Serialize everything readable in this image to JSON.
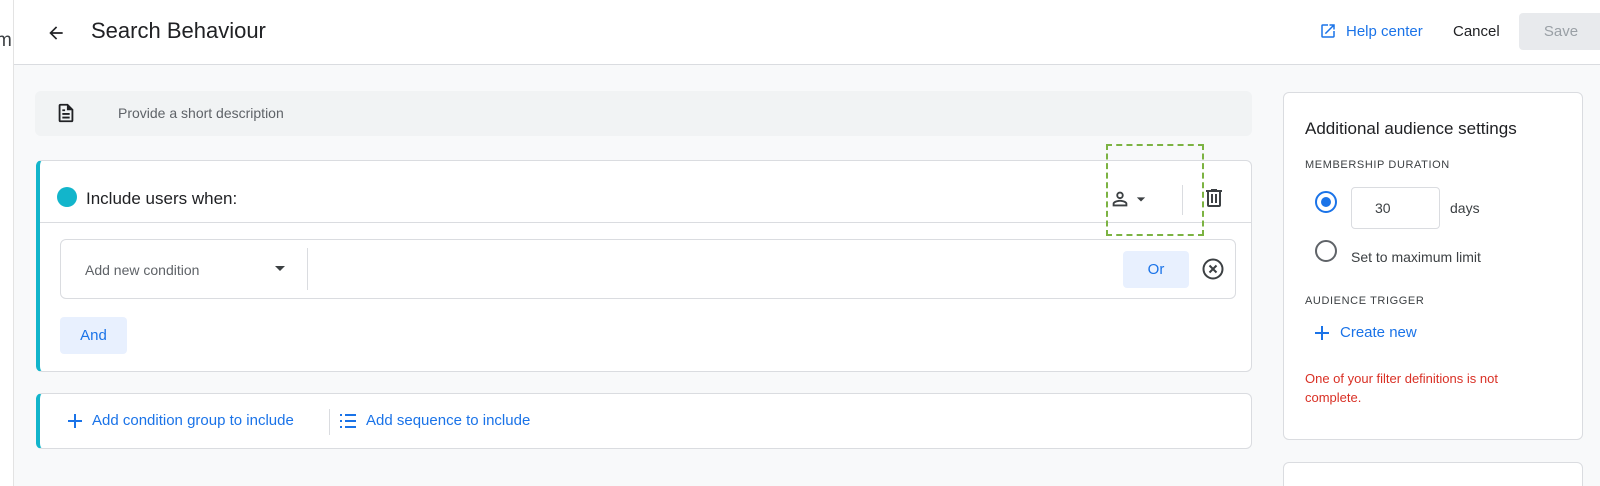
{
  "background_window": {
    "fragment_text": "m"
  },
  "header": {
    "title": "Search Behaviour",
    "help_label": "Help center",
    "cancel_label": "Cancel",
    "save_label": "Save"
  },
  "description": {
    "placeholder": "Provide a short description"
  },
  "condition_group": {
    "include_label": "Include users when:",
    "condition_placeholder": "Add new condition",
    "or_label": "Or",
    "and_label": "And"
  },
  "add_bar": {
    "add_group_label": "Add condition group to include",
    "add_sequence_label": "Add sequence to include"
  },
  "side_panel": {
    "title": "Additional audience settings",
    "membership_label": "MEMBERSHIP DURATION",
    "days_value": "30",
    "days_label": "days",
    "max_label": "Set to maximum limit",
    "trigger_label": "AUDIENCE TRIGGER",
    "create_new_label": "Create new",
    "error_text": "One of your filter definitions is not complete.",
    "selected_option": "days"
  },
  "colors": {
    "accent": "#1a73e8",
    "group_accent": "#12b5cb",
    "error": "#d93025",
    "highlight": "#7cb342"
  },
  "icons": [
    "arrow-back-icon",
    "open-in-new-icon",
    "document-icon",
    "person-icon",
    "dropdown-arrow-icon",
    "trash-icon",
    "close-circle-icon",
    "plus-icon",
    "sequence-list-icon"
  ]
}
